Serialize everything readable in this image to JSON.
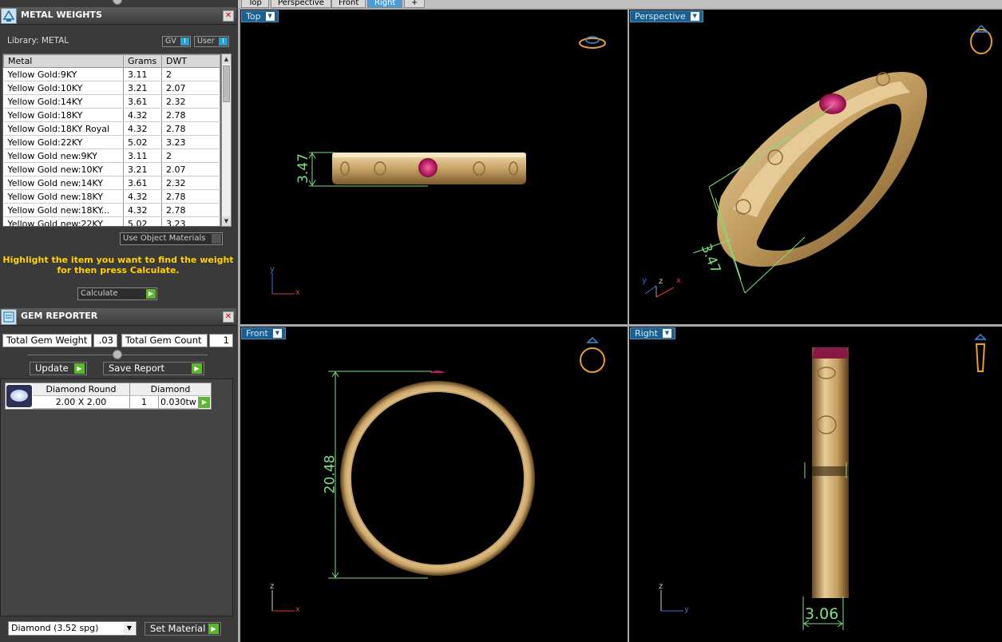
{
  "metal_panel": {
    "title": "METAL WEIGHTS",
    "library_label": "Library: METAL",
    "gv_label": "GV",
    "user_label": "User",
    "columns": [
      "Metal",
      "Grams",
      "DWT"
    ],
    "rows": [
      {
        "metal": "Yellow Gold:9KY",
        "grams": "3.11",
        "dwt": "2"
      },
      {
        "metal": "Yellow Gold:10KY",
        "grams": "3.21",
        "dwt": "2.07"
      },
      {
        "metal": "Yellow Gold:14KY",
        "grams": "3.61",
        "dwt": "2.32"
      },
      {
        "metal": "Yellow Gold:18KY",
        "grams": "4.32",
        "dwt": "2.78"
      },
      {
        "metal": "Yellow Gold:18KY Royal",
        "grams": "4.32",
        "dwt": "2.78"
      },
      {
        "metal": "Yellow Gold:22KY",
        "grams": "5.02",
        "dwt": "3.23"
      },
      {
        "metal": "Yellow Gold new:9KY",
        "grams": "3.11",
        "dwt": "2"
      },
      {
        "metal": "Yellow Gold new:10KY",
        "grams": "3.21",
        "dwt": "2.07"
      },
      {
        "metal": "Yellow Gold new:14KY",
        "grams": "3.61",
        "dwt": "2.32"
      },
      {
        "metal": "Yellow Gold new:18KY",
        "grams": "4.32",
        "dwt": "2.78"
      },
      {
        "metal": "Yellow Gold new:18KY...",
        "grams": "4.32",
        "dwt": "2.78"
      },
      {
        "metal": "Yellow Gold new:22KY",
        "grams": "5.02",
        "dwt": "3.23"
      }
    ],
    "use_object_materials": "Use Object Materials",
    "hint_line1": "Highlight the item you want to find the weight",
    "hint_line2": "for then press Calculate.",
    "calculate_label": "Calculate"
  },
  "gem_panel": {
    "title": "GEM REPORTER",
    "total_weight_label": "Total Gem Weight",
    "total_weight_value": ".03",
    "total_count_label": "Total Gem Count",
    "total_count_value": "1",
    "update_label": "Update",
    "save_report_label": "Save Report",
    "gem": {
      "shape": "Diamond Round",
      "material": "Diamond",
      "size": "2.00 X 2.00",
      "count": "1",
      "weight": "0.030tw"
    },
    "material_select": "Diamond      (3.52 spg)",
    "set_material_label": "Set Material"
  },
  "viewport_tabs": [
    {
      "label": "Top",
      "active": false
    },
    {
      "label": "Perspective",
      "active": false
    },
    {
      "label": "Front",
      "active": false
    },
    {
      "label": "Right",
      "active": true
    },
    {
      "label": "+",
      "active": false
    }
  ],
  "views": {
    "top": {
      "label": "Top",
      "dimension": "3.47",
      "axis_v": "y",
      "axis_h": "x"
    },
    "perspective": {
      "label": "Perspective",
      "dimension": "3.47",
      "axis_y": "y",
      "axis_z": "z",
      "axis_x": "x"
    },
    "front": {
      "label": "Front",
      "dimension": "20.48",
      "axis_v": "z",
      "axis_h": "x"
    },
    "right": {
      "label": "Right",
      "dimension": "3.06",
      "axis_v": "z",
      "axis_h": "y"
    }
  },
  "colors": {
    "gold": "#c9a468",
    "ruby": "#c0185a",
    "dimension": "#7ee07e",
    "accent": "#4a9ed8"
  }
}
